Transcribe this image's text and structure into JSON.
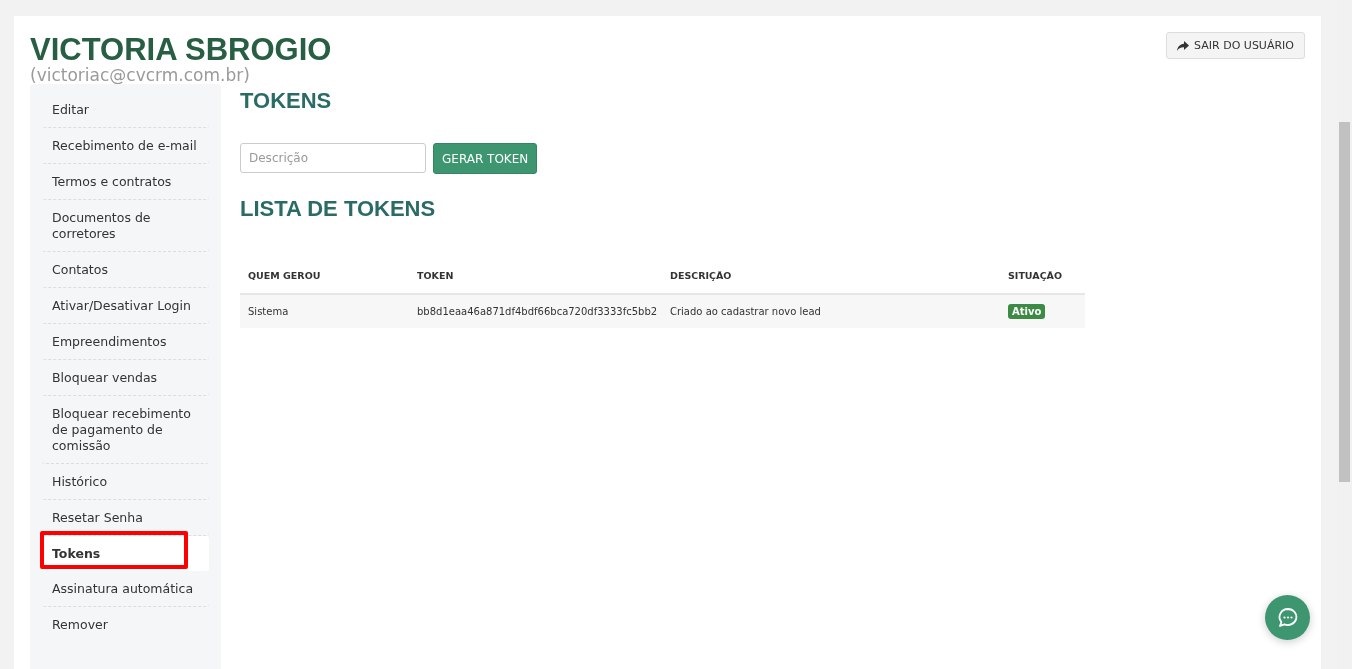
{
  "user": {
    "name": "VICTORIA SBROGIO",
    "email": "(victoriac@cvcrm.com.br)"
  },
  "logout_button": {
    "label": "SAIR DO USUÁRIO"
  },
  "sidebar": {
    "items": [
      {
        "label": "Editar",
        "selected": false
      },
      {
        "label": "Recebimento de e-mail",
        "selected": false
      },
      {
        "label": "Termos e contratos",
        "selected": false
      },
      {
        "label": "Documentos de corretores",
        "selected": false
      },
      {
        "label": "Contatos",
        "selected": false
      },
      {
        "label": "Ativar/Desativar Login",
        "selected": false
      },
      {
        "label": "Empreendimentos",
        "selected": false
      },
      {
        "label": "Bloquear vendas",
        "selected": false
      },
      {
        "label": "Bloquear recebimento de pagamento de comissão",
        "selected": false
      },
      {
        "label": "Histórico",
        "selected": false
      },
      {
        "label": "Resetar Senha",
        "selected": false
      },
      {
        "label": "Tokens",
        "selected": true
      },
      {
        "label": "Assinatura automática",
        "selected": false
      },
      {
        "label": "Remover",
        "selected": false
      }
    ]
  },
  "page_title": "TOKENS",
  "description_field": {
    "placeholder": "Descrição"
  },
  "generate_button": {
    "label": "GERAR TOKEN"
  },
  "list_title": "LISTA DE TOKENS",
  "table": {
    "columns": [
      "QUEM GEROU",
      "TOKEN",
      "DESCRIÇÃO",
      "SITUAÇÃO"
    ],
    "rows": [
      {
        "generated_by": "Sistema",
        "token": "bb8d1eaa46a871df4bdf66bca720df3333fc5bb2",
        "description": "Criado ao cadastrar novo lead",
        "status": "Ativo"
      }
    ]
  }
}
